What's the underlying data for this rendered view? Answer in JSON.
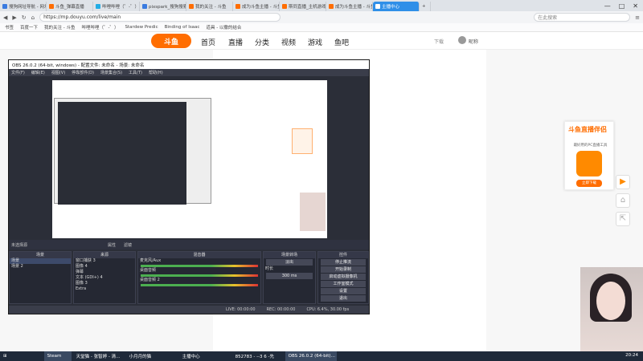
{
  "browser": {
    "tabs": [
      {
        "label": "搜狗网址导航 - 网址",
        "color": "#3a7be0"
      },
      {
        "label": "斗鱼_弹幕直播",
        "color": "#ff6d00"
      },
      {
        "label": "哔哩哔哩（゜-゜）",
        "color": "#23ade5"
      },
      {
        "label": "pixspark_搜狗搜索",
        "color": "#3a7be0"
      },
      {
        "label": "我的关注 - 斗鱼",
        "color": "#ff6d00"
      },
      {
        "label": "成为斗鱼主播 - 斗鱼",
        "color": "#ff6d00"
      },
      {
        "label": "斯同直播_主机游戏",
        "color": "#ff6d00"
      },
      {
        "label": "成为斗鱼主播 - 斗鱼",
        "color": "#ff6d00"
      },
      {
        "label": "主播中心",
        "color": "#ffffff",
        "active": true
      }
    ],
    "new_tab": "+",
    "url": "https://mp.douyu.com/live/main",
    "search_placeholder": "在此搜索",
    "bookmarks": [
      "书签",
      "百度一下",
      "我的关注 - 斗鱼",
      "哔哩哔哩（゜-゜）",
      "Stardew Predic",
      "Binding of Isaac",
      "道具 - 以撒的结合"
    ],
    "window_controls": [
      "—",
      "□",
      "✕"
    ]
  },
  "douyu": {
    "logo": "斗鱼",
    "nav": [
      "首页",
      "直播",
      "分类",
      "视频",
      "游戏",
      "鱼吧"
    ],
    "download": "下载",
    "user": "昵称"
  },
  "obs": {
    "title": "OBS 26.0.2 (64-bit, windows) - 配置文件: 未命名 - 场景: 未命名",
    "menu": [
      "文件(F)",
      "编辑(E)",
      "视图(V)",
      "停靠部件(D)",
      "场景集合(S)",
      "工具(T)",
      "帮助(H)"
    ],
    "no_source": "未选择源",
    "props_btn": "属性",
    "filter_btn": "滤镜",
    "docks": {
      "scenes": {
        "title": "场景",
        "items": [
          "场景",
          "场景 2"
        ]
      },
      "sources": {
        "title": "来源",
        "items": [
          "窗口捕获 3",
          "图像 4",
          "弹幕",
          "文本 (GDI+) 4",
          "图像 3",
          "Extra"
        ]
      },
      "mixer": {
        "title": "混音器",
        "tracks": [
          {
            "name": "麦克风/Aux",
            "db": "0.0 dB"
          },
          {
            "name": "桌面音频",
            "db": "0.0 dB"
          },
          {
            "name": "桌面音频 2",
            "db": "0.0 dB"
          }
        ]
      },
      "transitions": {
        "title": "场景转场",
        "type": "淡出",
        "duration_label": "时长",
        "duration": "300 ms"
      },
      "controls": {
        "title": "控件",
        "buttons": [
          "停止推流",
          "开始录制",
          "启动虚拟摄像机",
          "工作室模式",
          "设置",
          "退出"
        ]
      }
    },
    "status": {
      "live": "LIVE: 00:00:00",
      "rec": "REC: 00:00:00",
      "cpu": "CPU: 6.4%, 30.00 fps"
    }
  },
  "promo": {
    "title": "斗鱼直播伴侣",
    "subtitle": "最好用的PC直播工具",
    "button": "立即下载"
  },
  "side_buttons": [
    "▶",
    "⌂",
    "⇱"
  ],
  "taskbar": {
    "items": [
      {
        "label": "⊞",
        "on": false
      },
      {
        "label": "Steam",
        "on": true
      },
      {
        "label": "天堂猫 - 张智婷 - 清…",
        "on": false
      },
      {
        "label": "小月月的猫",
        "on": false
      },
      {
        "label": "主播中心",
        "on": false
      },
      {
        "label": "852783 - --3 6 -先",
        "on": false
      },
      {
        "label": "OBS 26.0.2 (64-bit)…",
        "on": true
      }
    ],
    "tray_time": "20:24"
  }
}
